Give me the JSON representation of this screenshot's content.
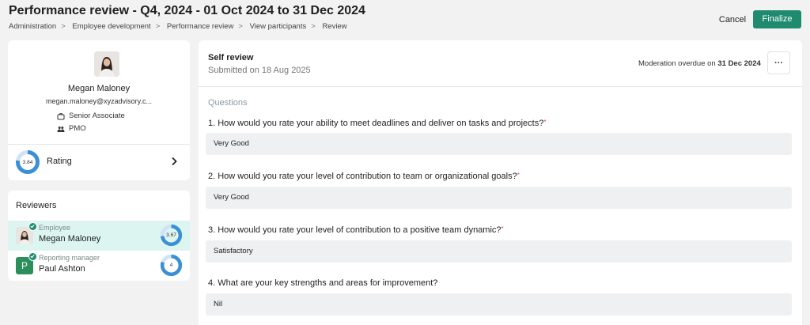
{
  "header": {
    "title": "Performance review - Q4, 2024 - 01 Oct 2024 to 31 Dec 2024",
    "breadcrumb": [
      "Administration",
      "Employee development",
      "Performance review",
      "View participants",
      "Review"
    ],
    "cancel_label": "Cancel",
    "finalize_label": "Finalize"
  },
  "profile": {
    "name": "Megan Maloney",
    "email": "megan.maloney@xyzadvisory.c...",
    "designation": "Senior Associate",
    "department": "PMO",
    "rating_value": "3.84",
    "rating_label": "Rating",
    "rating_fraction": 0.77
  },
  "reviewers": {
    "title": "Reviewers",
    "items": [
      {
        "role": "Employee",
        "name": "Megan Maloney",
        "score": "3.67",
        "fraction": 0.73,
        "avatar": "photo"
      },
      {
        "role": "Reporting manager",
        "name": "Paul Ashton",
        "score": "4",
        "fraction": 0.8,
        "avatar_letter": "P"
      }
    ]
  },
  "review": {
    "title": "Self review",
    "submitted": "Submitted on 18 Aug 2025",
    "moderation_prefix": "Moderation overdue on",
    "moderation_date": "31 Dec 2024",
    "more_label": "···",
    "questions_heading": "Questions",
    "questions": [
      {
        "text": "1. How would you rate your ability to meet deadlines and deliver on tasks and projects?",
        "required": "*",
        "answer": "Very Good"
      },
      {
        "text": "2. How would you rate your level of contribution to team or organizational goals?",
        "required": "*",
        "answer": "Very Good"
      },
      {
        "text": "3. How would you rate your level of contribution to a positive team dynamic?",
        "required": "*",
        "answer": "Satisfactory"
      },
      {
        "text": "4. What are your key strengths and areas for improvement?",
        "required": "",
        "answer": "Nil"
      }
    ]
  },
  "colors": {
    "accent": "#1e8a6e",
    "donut": "#3b8fd6",
    "donut_track": "#cfe3f5"
  }
}
